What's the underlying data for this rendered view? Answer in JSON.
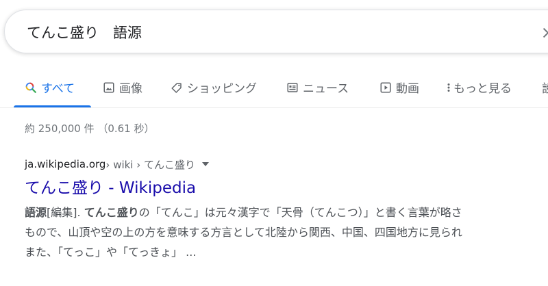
{
  "search": {
    "query": "てんこ盛り　語源"
  },
  "tabs": [
    {
      "label": "すべて",
      "icon": "search-icon"
    },
    {
      "label": "画像",
      "icon": "image-icon"
    },
    {
      "label": "ショッピング",
      "icon": "tag-icon"
    },
    {
      "label": "ニュース",
      "icon": "newspaper-icon"
    },
    {
      "label": "動画",
      "icon": "play-icon"
    },
    {
      "label": "もっと見る",
      "icon": "more-vert-icon"
    },
    {
      "label": "設",
      "icon": ""
    }
  ],
  "result_stats": "約 250,000 件 （0.61 秒）",
  "result": {
    "domain": "ja.wikipedia.org",
    "breadcrumbs": " › wiki › てんこ盛り",
    "title": "てんこ盛り - Wikipedia",
    "snippet": {
      "l1_b1": "語源",
      "l1_t1": "[編集]. ",
      "l1_b2": "てんこ盛り",
      "l1_t2": "の「てんこ」は元々漢字で「天骨（てんこつ）」と書く言葉が略さ",
      "l2": "もので、山頂や空の上の方を意味する方言として北陸から関西、中国、四国地方に見られ",
      "l3": "また、「てっこ」や「てっきょ」 ..."
    }
  },
  "colors": {
    "accent": "#1a73e8",
    "link": "#1a0dab",
    "muted": "#70757a"
  }
}
